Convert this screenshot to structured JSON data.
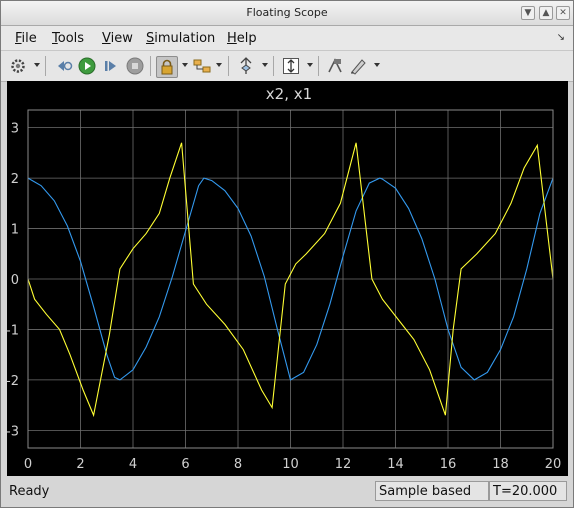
{
  "window": {
    "title": "Floating Scope"
  },
  "menu": {
    "file": "File",
    "tools": "Tools",
    "view": "View",
    "simulation": "Simulation",
    "help": "Help"
  },
  "status": {
    "text": "Ready",
    "mode": "Sample based",
    "time": "T=20.000"
  },
  "colors": {
    "x1": "#ffff33",
    "x2": "#3399ee",
    "grid": "#6e6e6e"
  },
  "chart_data": {
    "type": "line",
    "title": "x2, x1",
    "xlim": [
      0,
      20
    ],
    "ylim": [
      -3.35,
      3.35
    ],
    "xticks": [
      0,
      2,
      4,
      6,
      8,
      10,
      12,
      14,
      16,
      18,
      20
    ],
    "yticks": [
      3,
      2,
      1,
      0,
      -1,
      -2,
      -3
    ],
    "grid": true,
    "series": [
      {
        "key": "x2",
        "x": [
          0,
          0.5,
          1,
          1.5,
          2,
          2.5,
          3,
          3.3,
          3.5,
          4,
          4.5,
          5,
          5.5,
          6,
          6.5,
          6.7,
          7,
          7.5,
          8,
          8.5,
          9,
          9.5,
          10,
          10.5,
          11,
          11.5,
          12,
          12.5,
          13,
          13.4,
          13.5,
          14,
          14.5,
          15,
          15.5,
          16,
          16.5,
          17,
          17.5,
          18,
          18.5,
          19,
          19.5,
          20
        ],
        "values": [
          2,
          1.85,
          1.55,
          1.05,
          0.35,
          -0.55,
          -1.5,
          -1.95,
          -2,
          -1.8,
          -1.35,
          -0.75,
          0.05,
          0.95,
          1.85,
          2,
          1.95,
          1.75,
          1.4,
          0.85,
          0.05,
          -1.0,
          -2,
          -1.85,
          -1.3,
          -0.5,
          0.45,
          1.35,
          1.9,
          2,
          1.98,
          1.8,
          1.4,
          0.8,
          0.0,
          -1.0,
          -1.75,
          -2.0,
          -1.85,
          -1.4,
          -0.75,
          0.2,
          1.3,
          2
        ]
      },
      {
        "key": "x1",
        "x": [
          0,
          0.25,
          0.7,
          1.2,
          1.6,
          2.1,
          2.5,
          3.1,
          3.5,
          4,
          4.5,
          5,
          5.4,
          5.85,
          6.3,
          6.8,
          7.5,
          8.2,
          8.9,
          9.3,
          9.8,
          10.2,
          10.6,
          11.3,
          11.9,
          12.5,
          13.1,
          13.5,
          14.1,
          14.7,
          15.3,
          15.9,
          16.2,
          16.5,
          17.1,
          17.8,
          18.4,
          18.9,
          19.4,
          20
        ],
        "values": [
          0,
          -0.4,
          -0.7,
          -1.0,
          -1.5,
          -2.2,
          -2.7,
          -1.1,
          0.2,
          0.6,
          0.9,
          1.3,
          2.0,
          2.7,
          -0.1,
          -0.5,
          -0.9,
          -1.4,
          -2.2,
          -2.55,
          -0.1,
          0.3,
          0.5,
          0.9,
          1.5,
          2.7,
          0.0,
          -0.4,
          -0.8,
          -1.2,
          -1.8,
          -2.7,
          -1.0,
          0.2,
          0.5,
          0.9,
          1.5,
          2.2,
          2.65,
          0.0
        ]
      }
    ]
  }
}
